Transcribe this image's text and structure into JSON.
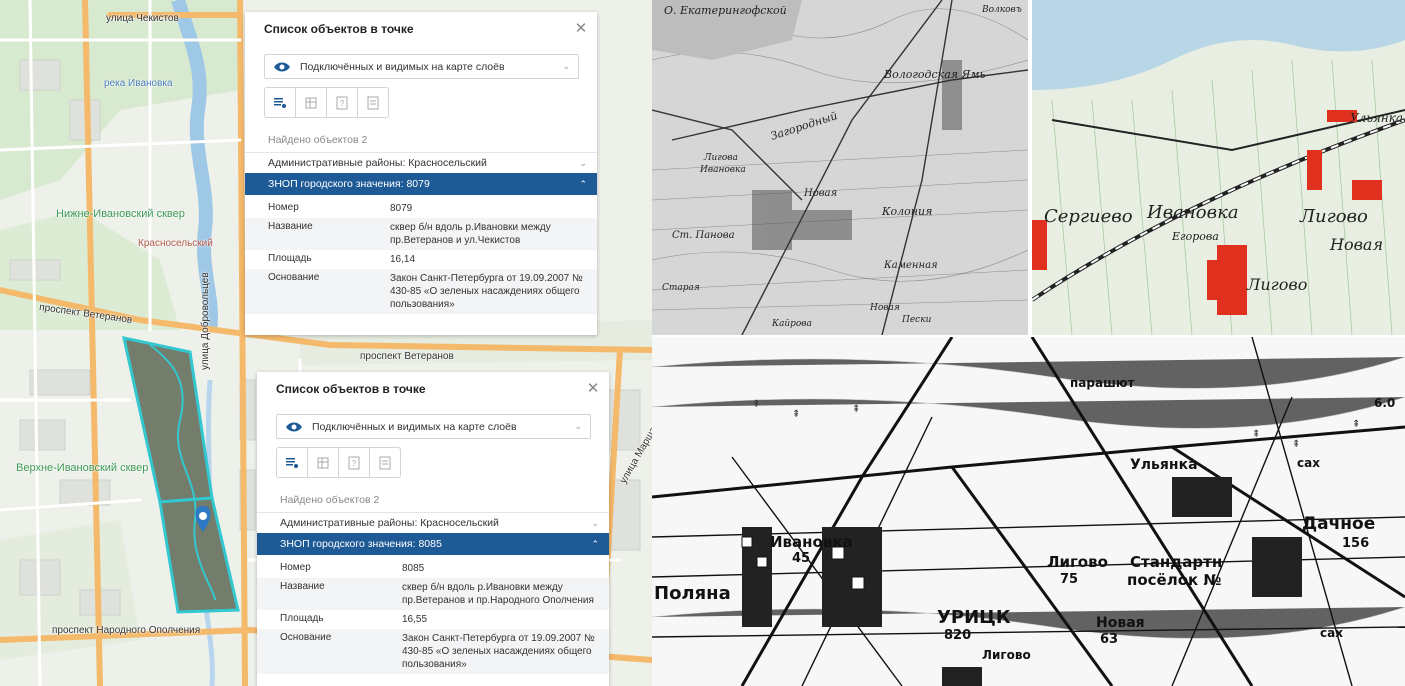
{
  "map": {
    "labels": {
      "street_chekistov": "улица Чекистов",
      "river_ivanovka": "река Ивановка",
      "park_lower": "Нижне-Ивановский сквер",
      "district_krasnoselsky": "Красносельский",
      "street_dobrovoltsev": "улица Добровольцев",
      "prospect_veteranov_left": "проспект Ветеранов",
      "prospect_veteranov_center": "проспект Ветеранов",
      "park_upper": "Верхне-Ивановский сквер",
      "prospect_narodnogo": "проспект Народного Ополчения",
      "street_marshala": "улица Маршала Жукова"
    },
    "colors": {
      "park": "#747c6c",
      "park_outline": "#33c8d0",
      "road": "#f4b96a",
      "marker": "#2f78c4"
    }
  },
  "popups": [
    {
      "title": "Список объектов в точке",
      "layer_select": "Подключённых и видимых на карте слоёв",
      "found": "Найдено объектов 2",
      "section": "Административные районы: Красносельский",
      "active": "ЗНОП городского значения: 8079",
      "attrs": [
        {
          "key": "Номер",
          "value": "8079"
        },
        {
          "key": "Название",
          "value": "сквер б/н вдоль р.Ивановки между пр.Ветеранов и ул.Чекистов"
        },
        {
          "key": "Площадь",
          "value": "16,14"
        },
        {
          "key": "Основание",
          "value": "Закон Санкт-Петербурга от 19.09.2007 № 430-85 «О зеленых насаждениях общего пользования»"
        }
      ]
    },
    {
      "title": "Список объектов в точке",
      "layer_select": "Подключённых и видимых на карте слоёв",
      "found": "Найдено объектов 2",
      "section": "Административные районы: Красносельский",
      "active": "ЗНОП городского значения: 8085",
      "attrs": [
        {
          "key": "Номер",
          "value": "8085"
        },
        {
          "key": "Название",
          "value": "сквер б/н вдоль р.Ивановки между пр.Ветеранов и пр.Народного Ополчения"
        },
        {
          "key": "Площадь",
          "value": "16,55"
        },
        {
          "key": "Основание",
          "value": "Закон Санкт-Петербурга от 19.09.2007 № 430-85 «О зеленых насаждениях общего пользования»"
        }
      ]
    }
  ],
  "historic_maps": {
    "top_left": {
      "labels": [
        "О. Екатерингофской",
        "Вологодская Ямь",
        "Загородный",
        "Лигова",
        "Ивановка",
        "Новая",
        "Колония",
        "Ст. Панова",
        "Каменная",
        "Старая",
        "Новая",
        "Пески",
        "Кайрова",
        "Волковъ"
      ]
    },
    "top_right": {
      "labels": [
        "Сергиево",
        "Ивановка",
        "Лигово",
        "Новая",
        "Ульянка",
        "Егорова",
        "Лигово"
      ]
    },
    "bottom": {
      "labels": [
        "Ульянка",
        "Дачное",
        "156",
        "Ивановка",
        "45",
        "Поляна",
        "Лигово",
        "Стандартн",
        "посёлок №",
        "75",
        "УРИЦК",
        "820",
        "Новая",
        "63",
        "Лигово",
        "сах",
        "сах",
        "парашют",
        "6.0"
      ]
    }
  }
}
